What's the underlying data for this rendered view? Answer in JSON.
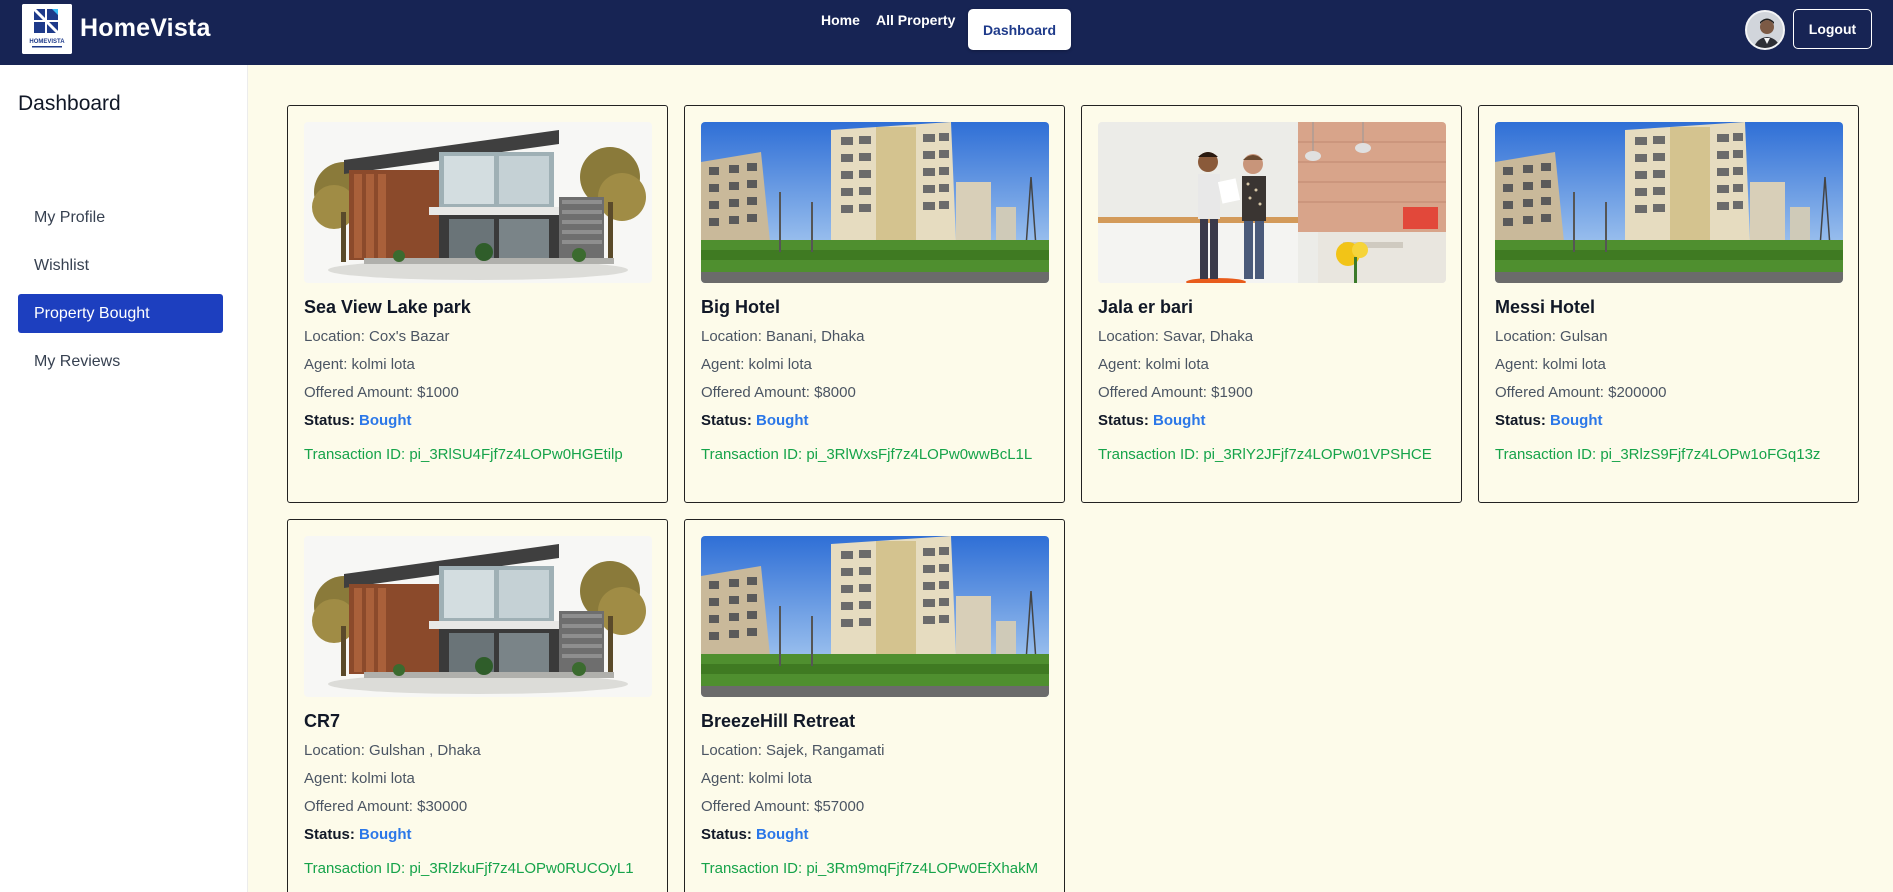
{
  "navbar": {
    "brand": "HomeVista",
    "logo_text": "HOMEVISTA",
    "links": [
      "Home",
      "All Property"
    ],
    "active_link": "Dashboard",
    "logout_label": "Logout"
  },
  "sidebar": {
    "title": "Dashboard",
    "items": [
      {
        "label": "My Profile",
        "active": false
      },
      {
        "label": "Wishlist",
        "active": false
      },
      {
        "label": "Property Bought",
        "active": true
      },
      {
        "label": "My Reviews",
        "active": false
      }
    ]
  },
  "labels": {
    "status": "Status:"
  },
  "properties": [
    {
      "title": "Sea View Lake park",
      "location": "Location: Cox's Bazar",
      "agent": "Agent: kolmi lota",
      "amount": "Offered Amount: $1000",
      "status": "Bought",
      "transaction": "Transaction ID: pi_3RlSU4Fjf7z4LOPw0HGEtilp",
      "image": "modern-house"
    },
    {
      "title": "Big Hotel",
      "location": "Location: Banani, Dhaka",
      "agent": "Agent: kolmi lota",
      "amount": "Offered Amount: $8000",
      "status": "Bought",
      "transaction": "Transaction ID: pi_3RlWxsFjf7z4LOPw0wwBcL1L",
      "image": "apartment-buildings"
    },
    {
      "title": "Jala er bari",
      "location": "Location: Savar, Dhaka",
      "agent": "Agent: kolmi lota",
      "amount": "Offered Amount: $1900",
      "status": "Bought",
      "transaction": "Transaction ID: pi_3RlY2JFjf7z4LOPw01VPSHCE",
      "image": "office-interior"
    },
    {
      "title": "Messi Hotel",
      "location": "Location: Gulsan",
      "agent": "Agent: kolmi lota",
      "amount": "Offered Amount: $200000",
      "status": "Bought",
      "transaction": "Transaction ID: pi_3RlzS9Fjf7z4LOPw1oFGq13z",
      "image": "apartment-buildings"
    },
    {
      "title": "CR7",
      "location": "Location: Gulshan , Dhaka",
      "agent": "Agent: kolmi lota",
      "amount": "Offered Amount: $30000",
      "status": "Bought",
      "transaction": "Transaction ID: pi_3RlzkuFjf7z4LOPw0RUCOyL1",
      "image": "modern-house"
    },
    {
      "title": "BreezeHill Retreat",
      "location": "Location: Sajek, Rangamati",
      "agent": "Agent: kolmi lota",
      "amount": "Offered Amount: $57000",
      "status": "Bought",
      "transaction": "Transaction ID: pi_3Rm9mqFjf7z4LOPw0EfXhakM",
      "image": "apartment-buildings"
    }
  ],
  "colors": {
    "navbar": "#172454",
    "accent": "#1d3fbf",
    "page_bg": "#fdfbea",
    "status": "#2b77e8",
    "transaction": "#16a34a"
  }
}
